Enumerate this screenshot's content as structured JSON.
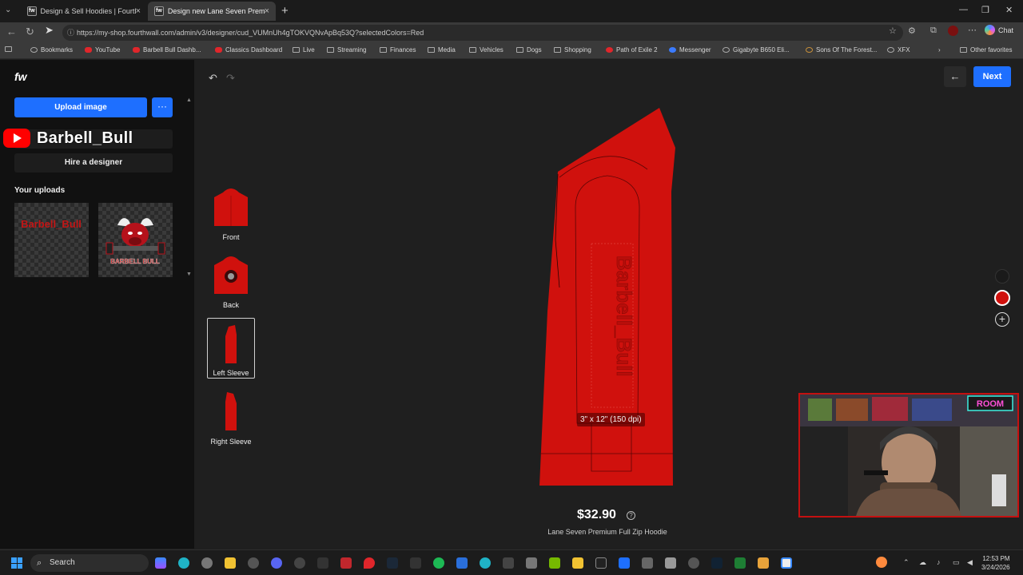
{
  "browser": {
    "tabs": [
      {
        "title": "Design & Sell Hoodies | Fourthwall",
        "active": false
      },
      {
        "title": "Design new Lane Seven Premium F",
        "active": true
      }
    ],
    "url": "https://my-shop.fourthwall.com/admin/v3/designer/cud_VUMnUh4gTOKVQNvApBq53Q?selectedColors=Red",
    "chat_label": "Chat",
    "bookmarks": [
      "Bookmarks",
      "YouTube",
      "Barbell Bull Dashb...",
      "Classics Dashboard",
      "Live",
      "Streaming",
      "Finances",
      "Media",
      "Vehicles",
      "Dogs",
      "Shopping",
      "Path of Exile 2",
      "Messenger",
      "Gigabyte B650 Eli...",
      "Sons Of The Forest...",
      "XFX"
    ],
    "other_favorites": "Other favorites"
  },
  "app": {
    "logo": "fw",
    "upload_label": "Upload image",
    "more_label": "···",
    "channel_name": "Barbell_Bull",
    "hire_label": "Hire a designer",
    "uploads_heading": "Your uploads",
    "upload_1_text": "Barbell_Bull",
    "upload_2_text": "BARBELL BULL",
    "views": [
      {
        "label": "Front"
      },
      {
        "label": "Back"
      },
      {
        "label": "Left Sleeve"
      },
      {
        "label": "Right Sleeve"
      }
    ],
    "next_label": "Next",
    "back_icon": "arrow-left-icon",
    "print_area": "3\" x 12\" (150 dpi)",
    "sleeve_text": "Barbell_Bull",
    "price": "$32.90",
    "info_mark": "?",
    "product_name": "Lane Seven Premium Full Zip Hoodie",
    "colors": {
      "selected": "#d0110d",
      "other": "#1a1a1a"
    }
  },
  "webcam": {
    "sign_text": "ROOM"
  },
  "taskbar": {
    "search_label": "Search",
    "time": "12:53 PM",
    "date": "3/24/2026"
  }
}
